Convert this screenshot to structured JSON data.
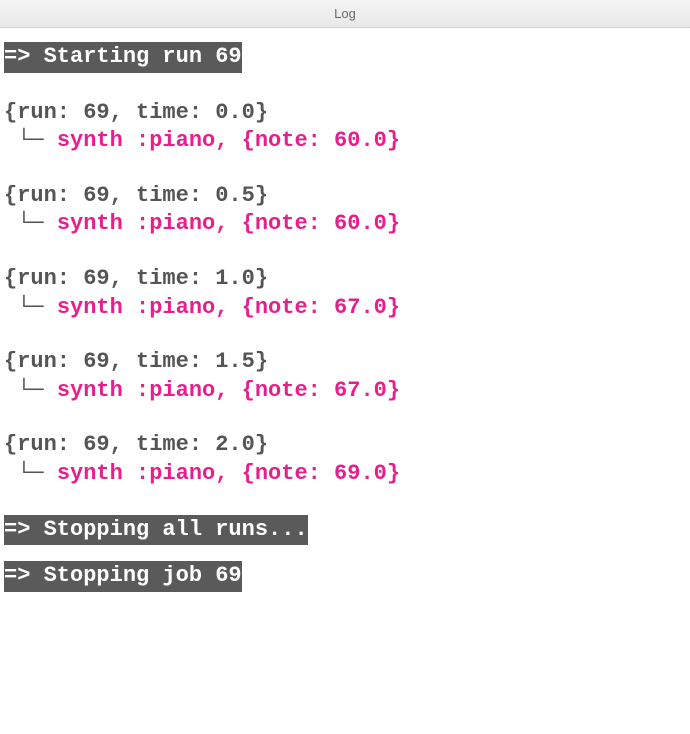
{
  "window": {
    "title": "Log"
  },
  "banners": {
    "start": "=> Starting run 69",
    "stop_all": "=> Stopping all runs...",
    "stop_job": "=> Stopping job 69"
  },
  "events": [
    {
      "header": "{run: 69, time: 0.0}",
      "tree": " └─ ",
      "detail": "synth :piano, {note: 60.0}"
    },
    {
      "header": "{run: 69, time: 0.5}",
      "tree": " └─ ",
      "detail": "synth :piano, {note: 60.0}"
    },
    {
      "header": "{run: 69, time: 1.0}",
      "tree": " └─ ",
      "detail": "synth :piano, {note: 67.0}"
    },
    {
      "header": "{run: 69, time: 1.5}",
      "tree": " └─ ",
      "detail": "synth :piano, {note: 67.0}"
    },
    {
      "header": "{run: 69, time: 2.0}",
      "tree": " └─ ",
      "detail": "synth :piano, {note: 69.0}"
    }
  ]
}
